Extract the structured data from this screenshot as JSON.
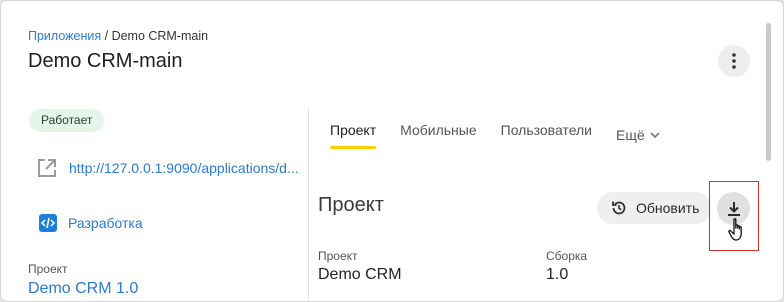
{
  "breadcrumb": {
    "parent": "Приложения",
    "separator": " / ",
    "current": "Demo CRM-main"
  },
  "page_title": "Demo CRM-main",
  "status": "Работает",
  "app_url": "http://127.0.0.1:9090/applications/d...",
  "dev_link": "Разработка",
  "left_info": {
    "label": "Проект",
    "value": "Demo CRM 1.0"
  },
  "tabs": [
    {
      "label": "Проект",
      "active": true
    },
    {
      "label": "Мобильные",
      "active": false
    },
    {
      "label": "Пользователи",
      "active": false
    },
    {
      "label": "Ещё",
      "active": false
    }
  ],
  "section": {
    "title": "Проект",
    "refresh_label": "Обновить",
    "fields": [
      {
        "label": "Проект",
        "value": "Demo CRM"
      },
      {
        "label": "Сборка",
        "value": "1.0"
      }
    ]
  },
  "icons": {
    "menu": "more-vertical-icon",
    "external": "external-link-icon",
    "dev": "code-icon",
    "refresh": "refresh-clock-icon",
    "download": "download-icon",
    "cursor": "hand-pointer-icon"
  },
  "colors": {
    "link": "#2a7bd3",
    "status_bg": "#e6f5e9",
    "active_tab": "#f5d100",
    "highlight": "#d32f2f"
  }
}
